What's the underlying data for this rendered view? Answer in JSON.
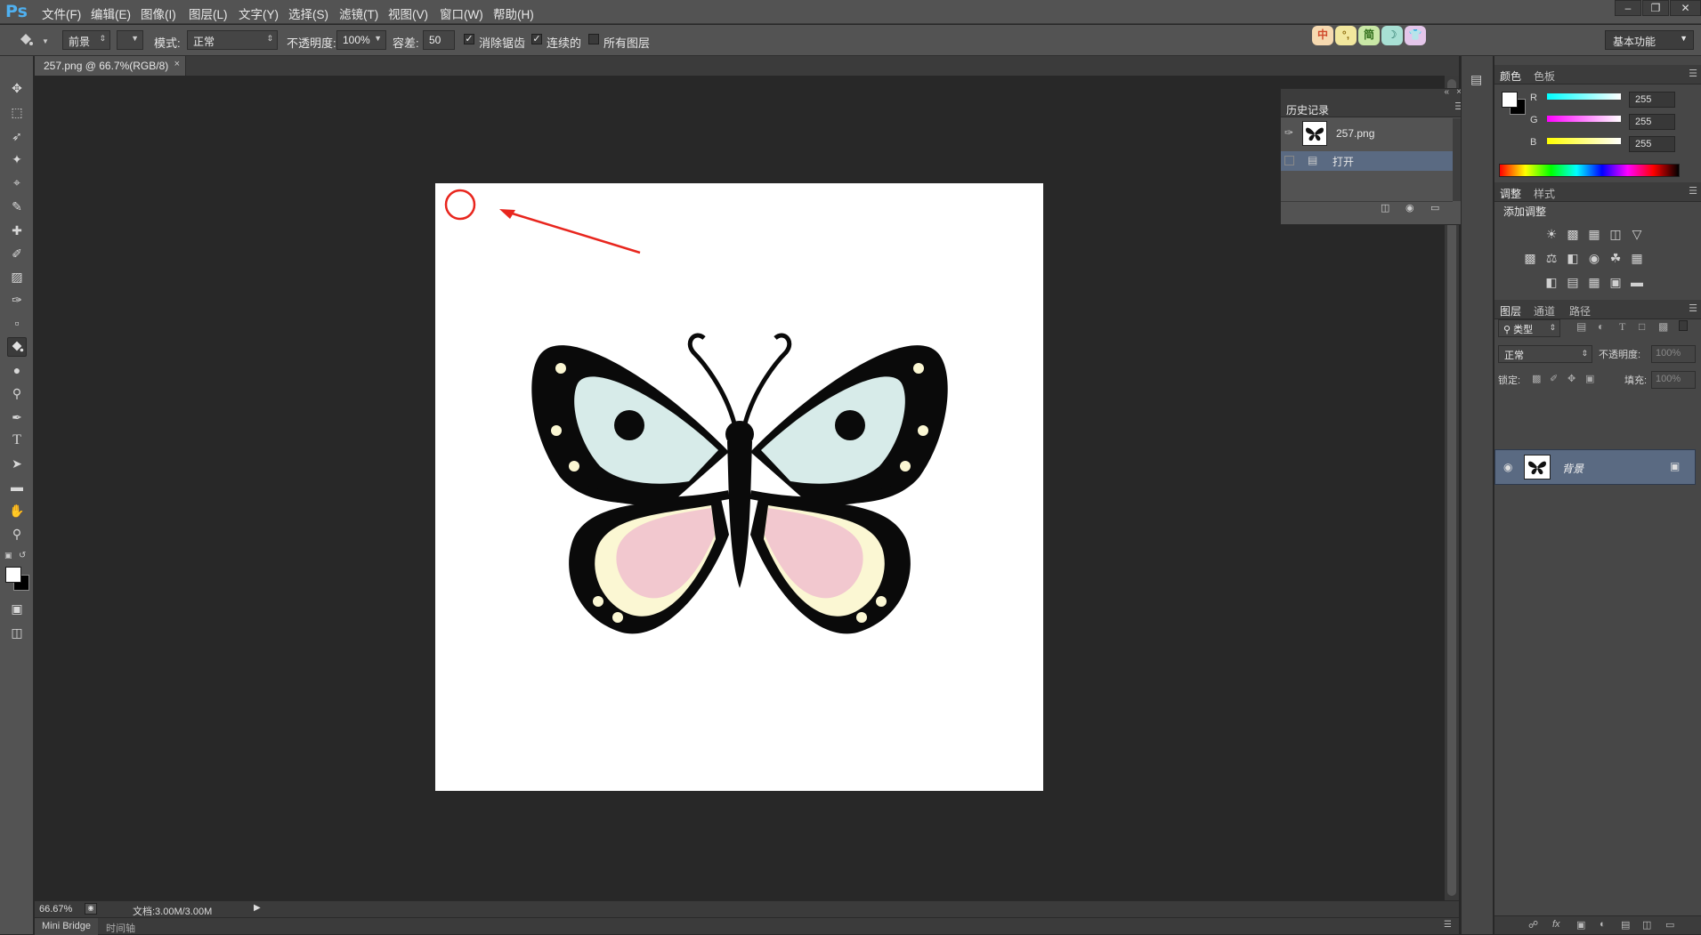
{
  "app": {
    "logo": "Ps"
  },
  "menu": [
    "文件(F)",
    "编辑(E)",
    "图像(I)",
    "图层(L)",
    "文字(Y)",
    "选择(S)",
    "滤镜(T)",
    "视图(V)",
    "窗口(W)",
    "帮助(H)"
  ],
  "options": {
    "fill_source": "前景",
    "mode_label": "模式:",
    "mode_value": "正常",
    "opacity_label": "不透明度:",
    "opacity_value": "100%",
    "tolerance_label": "容差:",
    "tolerance_value": "50",
    "antialias_label": "消除锯齿",
    "antialias_checked": true,
    "contiguous_label": "连续的",
    "contiguous_checked": true,
    "all_layers_label": "所有图层",
    "all_layers_checked": false,
    "workspace": "基本功能",
    "ime_buttons": [
      "中",
      "°,",
      "简",
      "☽",
      "👕"
    ]
  },
  "document": {
    "tab_title": "257.png @ 66.7%(RGB/8)",
    "zoom": "66.67%",
    "doc_size": "文档:3.00M/3.00M"
  },
  "bottom_tabs": [
    "Mini Bridge",
    "时间轴"
  ],
  "history": {
    "tab": "历史记录",
    "snapshot_name": "257.png",
    "steps": [
      "打开"
    ]
  },
  "color_panel": {
    "tabs": [
      "颜色",
      "色板"
    ],
    "channels": [
      {
        "label": "R",
        "value": "255"
      },
      {
        "label": "G",
        "value": "255"
      },
      {
        "label": "B",
        "value": "255"
      }
    ]
  },
  "adjustments_panel": {
    "tabs": [
      "调整",
      "样式"
    ],
    "title": "添加调整"
  },
  "layers_panel": {
    "tabs": [
      "图层",
      "通道",
      "路径"
    ],
    "filter_kind": "类型",
    "blend_mode": "正常",
    "opacity_label": "不透明度:",
    "opacity_value": "100%",
    "lock_label": "锁定:",
    "fill_label": "填充:",
    "fill_value": "100%",
    "layers": [
      {
        "name": "背景",
        "locked": true,
        "visible": true
      }
    ]
  },
  "colors": {
    "menubar": "#535353",
    "canvas_bg": "#282828",
    "layer_selected": "#5a6a82",
    "annotation": "#e8261e"
  }
}
